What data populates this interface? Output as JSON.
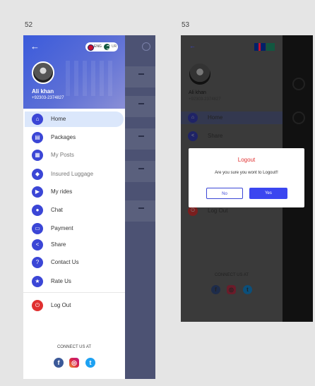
{
  "screens": {
    "left_number": "52",
    "right_number": "53"
  },
  "drawer": {
    "back_icon": "arrow-left-icon",
    "language": {
      "en": "ENG",
      "ur": "UR"
    },
    "user": {
      "name": "Ali khan",
      "phone": "+92303-2374827"
    },
    "menu": [
      {
        "label": "Home",
        "icon": "home-icon",
        "glyph": "⌂",
        "active": true
      },
      {
        "label": "Packages",
        "icon": "package-icon",
        "glyph": "▤"
      },
      {
        "label": "My Posts",
        "icon": "posts-icon",
        "glyph": "▦"
      },
      {
        "label": "Insured Luggage",
        "icon": "luggage-icon",
        "glyph": "◆"
      },
      {
        "label": "My rides",
        "icon": "truck-icon",
        "glyph": "▶"
      },
      {
        "label": "Chat",
        "icon": "chat-icon",
        "glyph": "●"
      },
      {
        "label": "Payment",
        "icon": "payment-icon",
        "glyph": "▭"
      },
      {
        "label": "Share",
        "icon": "share-icon",
        "glyph": "<"
      },
      {
        "label": "Contact Us",
        "icon": "question-icon",
        "glyph": "?"
      },
      {
        "label": "Rate Us",
        "icon": "star-icon",
        "glyph": "★"
      }
    ],
    "logout": {
      "label": "Log Out",
      "icon": "logout-icon",
      "glyph": "⏻"
    },
    "connect_title": "CONNECT US AT",
    "social": {
      "facebook": "f",
      "instagram": "◎",
      "twitter": "t"
    }
  },
  "logout_dialog": {
    "title": "Logout",
    "message": "Are you sure you wont to Logout!!",
    "no_label": "No",
    "yes_label": "Yes"
  },
  "colors": {
    "primary": "#3b46d6",
    "logout_red": "#e03131",
    "active_bg": "#dbe7fb",
    "overlay": "#3a3a3a"
  }
}
